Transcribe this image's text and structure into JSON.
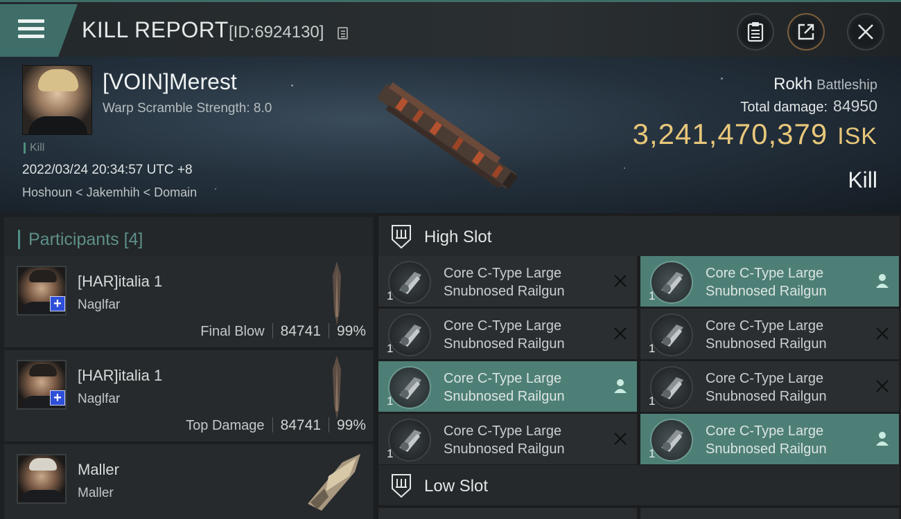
{
  "header": {
    "title": "KILL REPORT",
    "report_id": "[ID:6924130]"
  },
  "victim": {
    "name": "[VOIN]Merest",
    "warp_strength": "Warp Scramble Strength: 8.0",
    "tag": "Kill",
    "date": "2022/03/24 20:34:57 UTC +8",
    "location": "Hoshoun < Jakemhih < Domain",
    "ship_name": "Rokh",
    "ship_class": "Battleship",
    "total_damage_label": "Total damage:",
    "total_damage_value": "84950",
    "isk_value": "3,241,470,379",
    "isk_unit": "ISK",
    "result": "Kill"
  },
  "participants": {
    "title": "Participants",
    "count": "[4]",
    "items": [
      {
        "name": "[HAR]italia 1",
        "ship": "Naglfar",
        "label": "Final Blow",
        "damage": "84741",
        "percent": "99%"
      },
      {
        "name": "[HAR]italia 1",
        "ship": "Naglfar",
        "label": "Top Damage",
        "damage": "84741",
        "percent": "99%"
      },
      {
        "name": "Maller",
        "ship": "Maller"
      }
    ]
  },
  "fitting": {
    "high_slot_label": "High Slot",
    "low_slot_label": "Low Slot",
    "modules": [
      {
        "qty": "1",
        "name": "Core C-Type Large Snubnosed Railgun",
        "status": "destroyed",
        "icon": "close-icon"
      },
      {
        "qty": "1",
        "name": "Core C-Type Large Snubnosed Railgun",
        "status": "dropped",
        "icon": "person-icon"
      },
      {
        "qty": "1",
        "name": "Core C-Type Large Snubnosed Railgun",
        "status": "destroyed",
        "icon": "close-icon"
      },
      {
        "qty": "1",
        "name": "Core C-Type Large Snubnosed Railgun",
        "status": "destroyed",
        "icon": "close-icon"
      },
      {
        "qty": "1",
        "name": "Core C-Type Large Snubnosed Railgun",
        "status": "dropped",
        "icon": "person-icon"
      },
      {
        "qty": "1",
        "name": "Core C-Type Large Snubnosed Railgun",
        "status": "destroyed",
        "icon": "close-icon"
      },
      {
        "qty": "1",
        "name": "Core C-Type Large Snubnosed Railgun",
        "status": "destroyed",
        "icon": "close-icon"
      },
      {
        "qty": "1",
        "name": "Core C-Type Large Snubnosed Railgun",
        "status": "dropped",
        "icon": "person-icon"
      }
    ]
  },
  "colors": {
    "accent": "#4e7f76",
    "isk": "#e8c77a",
    "header_tab": "#3f6e69"
  }
}
